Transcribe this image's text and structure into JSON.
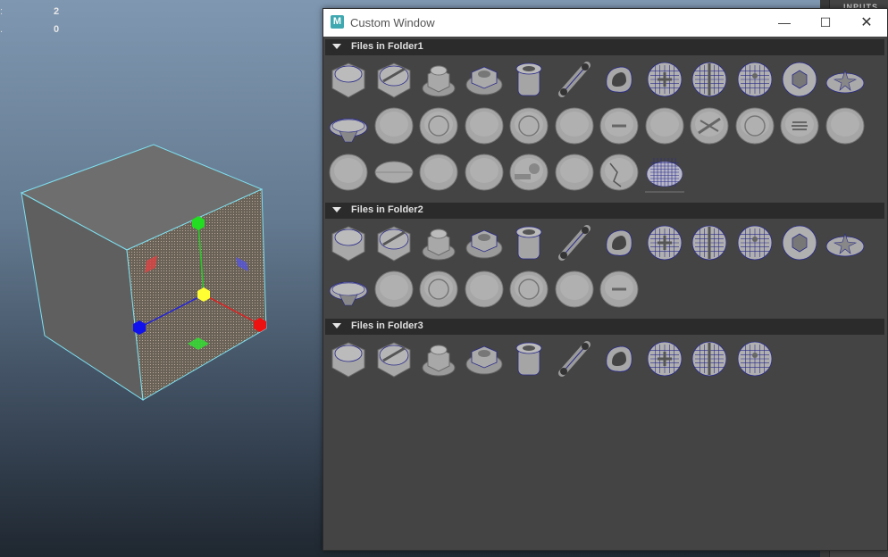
{
  "viewport": {
    "hud": [
      {
        "key": ":",
        "value": "2"
      },
      {
        "key": ".",
        "value": "0"
      }
    ]
  },
  "side_panel": {
    "label": "INPUTS"
  },
  "window": {
    "title": "Custom Window",
    "app_icon": "M",
    "buttons": {
      "minimize": "—",
      "maximize": "☐",
      "close": "✕"
    },
    "sections": [
      {
        "title": "Files in Folder1",
        "items": [
          "hex-bolt",
          "slot-bolt",
          "nut-cap",
          "flange-nut",
          "sleeve",
          "chain-link",
          "ring-loop",
          "phillips-dome",
          "slot-dome",
          "dimple-dome",
          "hex-socket",
          "star-cap",
          "disc-cap",
          "grip-disc",
          "plain-disc",
          "flat-disc",
          "recess-disc",
          "smooth-disc",
          "slot-disc",
          "notch-disc",
          "cross-disc",
          "round-cap",
          "vent-disc",
          "soft-disc",
          "bumpy-disc",
          "pill",
          "detail-disc",
          "scratch-disc",
          "key-disc",
          "cross-cut-disc",
          "crack-disc",
          "wire-dome"
        ]
      },
      {
        "title": "Files in Folder2",
        "items": [
          "hex-bolt",
          "slot-bolt",
          "nut-cap",
          "flange-nut",
          "sleeve",
          "chain-link",
          "ring-loop",
          "phillips-dome",
          "slot-dome",
          "dimple-dome",
          "hex-socket",
          "star-cap",
          "disc-cap",
          "grip-disc",
          "plain-disc",
          "flat-disc",
          "recess-disc",
          "smooth-disc",
          "slot-disc"
        ]
      },
      {
        "title": "Files in Folder3",
        "items": [
          "hex-bolt",
          "slot-bolt",
          "nut-cap",
          "flange-nut",
          "sleeve",
          "chain-link",
          "ring-loop",
          "phillips-dome",
          "slot-dome",
          "dimple-dome"
        ]
      }
    ]
  },
  "colors": {
    "window_bg": "#444444",
    "header_bg": "#2b2b2b",
    "wire": "#2a2a8a",
    "selection": "#7fe0f0"
  }
}
